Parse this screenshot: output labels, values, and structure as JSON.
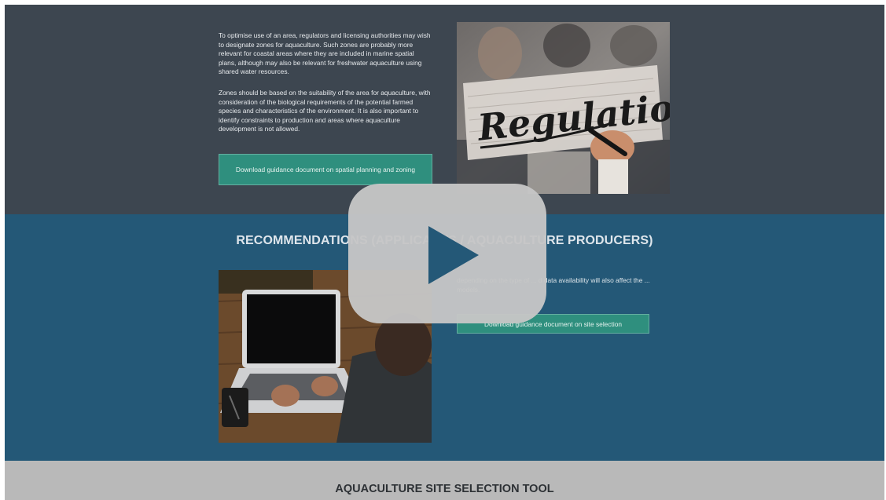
{
  "zoning": {
    "paragraph1": "To optimise use of an area, regulators and licensing authorities may wish to designate zones for aquaculture. Such zones are probably more relevant for coastal areas where they are included in marine spatial plans, although may also be relevant for freshwater aquaculture using shared water resources.",
    "paragraph2": "Zones should be based on the suitability of the area for aquaculture, with consideration of the biological requirements of the potential farmed species and characteristics of the environment. It is also important to identify constraints to production and areas where aquaculture development is not allowed.",
    "download_label": "Download guidance document on spatial planning and zoning",
    "image_text": "Regulations"
  },
  "recommendations": {
    "heading": "RECOMMENDATIONS (APPLICANTS / AQUACULTURE PRODUCERS)",
    "paragraph_partial": "depending on the type of ... d data availability will also affect the ... models.",
    "download_label": "Download guidance document on site selection"
  },
  "site_tool": {
    "title": "AQUACULTURE SITE SELECTION TOOL"
  },
  "video": {
    "play_icon": "play-icon"
  },
  "colors": {
    "top_band": "#3d4650",
    "mid_band": "#245877",
    "bottom_band": "#b9b9b9",
    "button": "#2f8f7e",
    "play_overlay": "#c6c6c6"
  }
}
